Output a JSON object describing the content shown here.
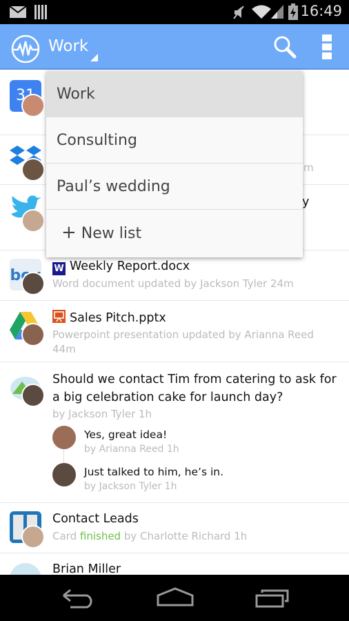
{
  "status_bar": {
    "time": "16:49",
    "icons": [
      "mail-icon",
      "barcode-icon",
      "mute-icon",
      "wifi-icon",
      "signal-icon",
      "battery-charging-icon"
    ]
  },
  "app_bar": {
    "title": "Work",
    "icons": [
      "pulse-logo-icon",
      "search-icon",
      "overflow-menu-icon"
    ]
  },
  "dropdown": {
    "items": [
      {
        "label": "Work",
        "selected": true
      },
      {
        "label": "Consulting"
      },
      {
        "label": "Paul’s wedding"
      }
    ],
    "new_list": "New list",
    "new_list_icon": "plus-icon"
  },
  "hidden_fragments": {
    "row2": "m",
    "row3": "y"
  },
  "feed": [
    {
      "app": "google-calendar",
      "app_icon_text": "31"
    },
    {
      "app": "dropbox"
    },
    {
      "app": "twitter"
    },
    {
      "app": "box",
      "file_icon": "W",
      "title": "Weekly Report.docx",
      "subtitle": "Word document updated by Jackson Tyler 24m"
    },
    {
      "app": "google-drive",
      "title": "Sales Pitch.pptx",
      "subtitle": "Powerpoint presentation updated by Arianna Reed 44m"
    },
    {
      "app": "basecamp",
      "title": "Should we contact Tim from catering to ask for a big celebration cake for launch day?",
      "subtitle": "by Jackson Tyler 1h",
      "replies": [
        {
          "text": "Yes, great idea!",
          "meta": "by Arianna Reed 1h"
        },
        {
          "text": "Just talked to him, he’s in.",
          "meta": "by Jackson Tyler 1h"
        }
      ]
    },
    {
      "app": "trello",
      "title": "Contact Leads",
      "subtitle_pre": "Card",
      "subtitle_status": "finished",
      "subtitle_post": "by Charlotte Richard 1h"
    },
    {
      "app": "unknown",
      "title": "Brian Miller"
    }
  ],
  "colors": {
    "app_bar": "#6eaaf8",
    "finished": "#6cbf4a",
    "dropdown_selected": "#e0e0e0"
  },
  "nav_bar": {
    "icons": [
      "back-icon",
      "home-icon",
      "recents-icon"
    ]
  }
}
